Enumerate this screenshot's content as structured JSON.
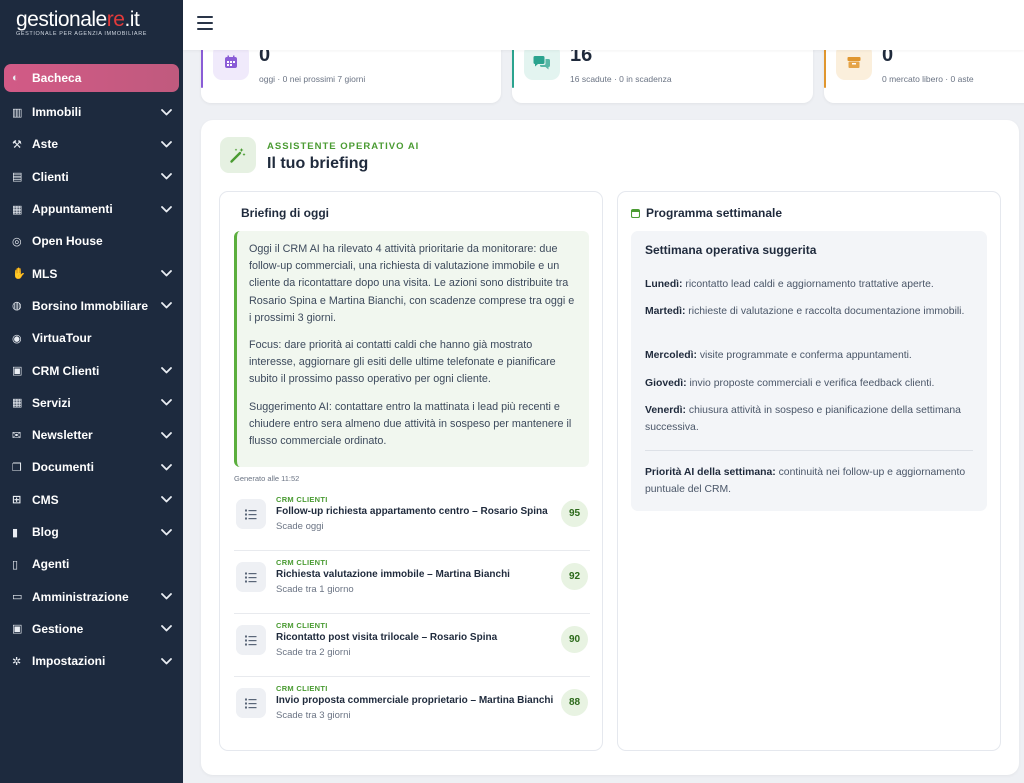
{
  "brand": {
    "logo_text_a": "gestionale",
    "logo_text_b": "re",
    "logo_text_c": ".it",
    "logo_sub": "GESTIONALE PER AGENZIA IMMOBILIARE"
  },
  "sidebar": {
    "items": [
      {
        "label": "Bacheca",
        "icon": "dashboard-icon",
        "chevron": false
      },
      {
        "label": "Immobili",
        "icon": "building-icon",
        "chevron": true
      },
      {
        "label": "Aste",
        "icon": "gavel-icon",
        "chevron": true
      },
      {
        "label": "Clienti",
        "icon": "id-card-icon",
        "chevron": true
      },
      {
        "label": "Appuntamenti",
        "icon": "calendar-icon",
        "chevron": true
      },
      {
        "label": "Open House",
        "icon": "headset-icon",
        "chevron": false
      },
      {
        "label": "MLS",
        "icon": "handshake-icon",
        "chevron": true
      },
      {
        "label": "Borsino Immobiliare",
        "icon": "globe-icon",
        "chevron": true
      },
      {
        "label": "VirtuaTour",
        "icon": "360-icon",
        "chevron": false
      },
      {
        "label": "CRM Clienti",
        "icon": "crm-icon",
        "chevron": true
      },
      {
        "label": "Servizi",
        "icon": "grid-icon",
        "chevron": true
      },
      {
        "label": "Newsletter",
        "icon": "envelope-icon",
        "chevron": true
      },
      {
        "label": "Documenti",
        "icon": "documents-icon",
        "chevron": true
      },
      {
        "label": "CMS",
        "icon": "sitemap-icon",
        "chevron": true
      },
      {
        "label": "Blog",
        "icon": "book-icon",
        "chevron": true
      },
      {
        "label": "Agenti",
        "icon": "agent-file-icon",
        "chevron": false
      },
      {
        "label": "Amministrazione",
        "icon": "address-card-icon",
        "chevron": true
      },
      {
        "label": "Gestione",
        "icon": "money-check-icon",
        "chevron": true
      },
      {
        "label": "Impostazioni",
        "icon": "gear-icon",
        "chevron": true
      }
    ]
  },
  "stats": [
    {
      "value": "0",
      "sub": "oggi · 0 nei prossimi 7 giorni",
      "icon": "calendar-icon",
      "color": "#8a5cd6"
    },
    {
      "value": "16",
      "sub": "16 scadute · 0 in scadenza",
      "icon": "chat-icon",
      "color": "#2aa38e"
    },
    {
      "value": "0",
      "sub": "0 mercato libero · 0 aste",
      "icon": "box-icon",
      "color": "#e0962e"
    }
  ],
  "assistant": {
    "kicker": "ASSISTENTE OPERATIVO AI",
    "title": "Il tuo briefing"
  },
  "briefing": {
    "title": "Briefing di oggi",
    "paragraphs": [
      "Oggi il CRM AI ha rilevato 4 attività prioritarie da monitorare: due follow-up commerciali, una richiesta di valutazione immobile e un cliente da ricontattare dopo una visita. Le azioni sono distribuite tra Rosario Spina e Martina Bianchi, con scadenze comprese tra oggi e i prossimi 3 giorni.",
      "Focus: dare priorità ai contatti caldi che hanno già mostrato interesse, aggiornare gli esiti delle ultime telefonate e pianificare subito il prossimo passo operativo per ogni cliente.",
      "Suggerimento AI: contattare entro la mattinata i lead più recenti e chiudere entro sera almeno due attività in sospeso per mantenere il flusso commerciale ordinato."
    ],
    "generated": "Generato alle 11:52",
    "tasks": [
      {
        "kicker": "CRM CLIENTI",
        "title": "Follow-up richiesta appartamento centro – Rosario Spina",
        "sub": "Scade oggi",
        "score": "95"
      },
      {
        "kicker": "CRM CLIENTI",
        "title": "Richiesta valutazione immobile – Martina Bianchi",
        "sub": "Scade tra 1 giorno",
        "score": "92"
      },
      {
        "kicker": "CRM CLIENTI",
        "title": "Ricontatto post visita trilocale – Rosario Spina",
        "sub": "Scade tra 2 giorni",
        "score": "90"
      },
      {
        "kicker": "CRM CLIENTI",
        "title": "Invio proposta commerciale proprietario – Martina Bianchi",
        "sub": "Scade tra 3 giorni",
        "score": "88"
      }
    ]
  },
  "program": {
    "title": "Programma settimanale",
    "heading": "Settimana operativa suggerita",
    "days": [
      {
        "day": "Lunedì:",
        "text": " ricontatto lead caldi e aggiornamento trattative aperte."
      },
      {
        "day": "Martedì:",
        "text": " richieste di valutazione e raccolta documentazione immobili."
      },
      {
        "day": "Mercoledì:",
        "text": " visite programmate e conferma appuntamenti."
      },
      {
        "day": "Giovedì:",
        "text": " invio proposte commerciali e verifica feedback clienti."
      },
      {
        "day": "Venerdì:",
        "text": " chiusura attività in sospeso e pianificazione della settimana successiva."
      }
    ],
    "priority_label": "Priorità AI della settimana:",
    "priority_text": " continuità nei follow-up e aggiornamento puntuale del CRM."
  }
}
